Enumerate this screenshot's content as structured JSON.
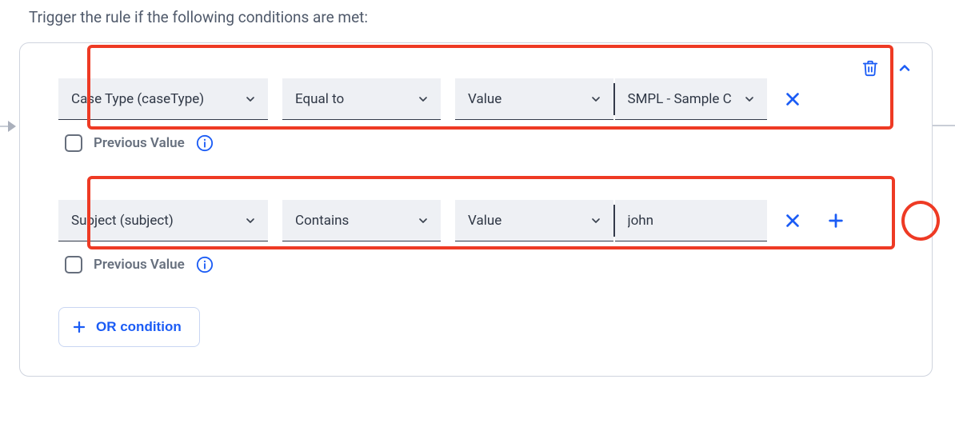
{
  "heading": "Trigger the rule if the following conditions are met:",
  "panel": {
    "conditions": [
      {
        "field_label": "Case Type (caseType)",
        "operator_label": "Equal to",
        "value_type_label": "Value",
        "value_mode": "select",
        "value_label": "SMPL - Sample C",
        "highlighted": true,
        "show_add": false
      },
      {
        "field_label": "Subject (subject)",
        "operator_label": "Contains",
        "value_type_label": "Value",
        "value_mode": "input",
        "value_label": "john",
        "highlighted": true,
        "show_add": true,
        "add_highlighted": true
      }
    ],
    "previous_value_label": "Previous Value",
    "or_button_label": "OR condition"
  },
  "icons": {
    "trash": "trash",
    "collapse": "chevron-up",
    "remove": "close",
    "add": "plus",
    "info": "info-circle",
    "dropdown": "chevron-down"
  }
}
